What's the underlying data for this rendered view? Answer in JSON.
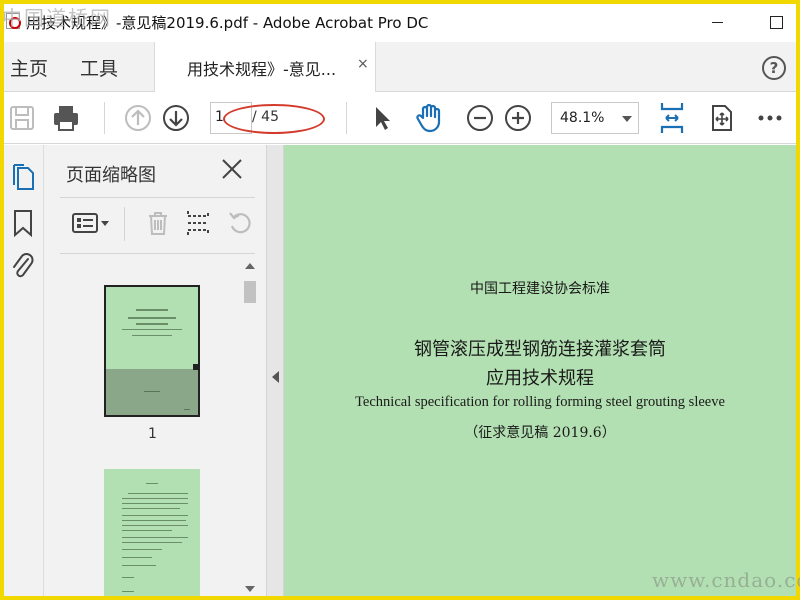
{
  "window": {
    "title": "用技术规程》-意见稿2019.6.pdf - Adobe Acrobat Pro DC"
  },
  "tabs": {
    "home": "主页",
    "tools": "工具",
    "document": "用技术规程》-意见...",
    "close": "×"
  },
  "toolbar": {
    "page_current": "1",
    "page_total": "/ 45",
    "zoom": "48.1%"
  },
  "thumbnails": {
    "title": "页面缩略图",
    "pages": [
      {
        "number": "1"
      }
    ]
  },
  "document": {
    "org": "中国工程建设协会标准",
    "title_line1": "钢管滚压成型钢筋连接灌浆套筒",
    "title_line2": "应用技术规程",
    "english_title": "Technical specification for rolling forming steel grouting sleeve",
    "draft": "（征求意见稿 2019.6）"
  },
  "watermarks": {
    "top": "中国道桥网",
    "bottom": "www.cndao.com"
  },
  "colors": {
    "page_background": "#b3e0b2",
    "accent_blue": "#1a6fb5",
    "highlight_red": "#d33b2c",
    "outer_border": "#f0d800"
  },
  "icons": {
    "save": "save-icon",
    "print": "print-icon",
    "prev_page": "arrow-up-circle-icon",
    "next_page": "arrow-down-circle-icon",
    "select": "pointer-icon",
    "hand": "hand-icon",
    "zoom_out": "minus-circle-icon",
    "zoom_in": "plus-circle-icon",
    "fit": "fit-page-icon",
    "scroll_mode": "scroll-mode-icon",
    "more": "more-icon",
    "pages_panel": "pages-icon",
    "bookmarks": "bookmark-icon",
    "attachments": "paperclip-icon"
  }
}
